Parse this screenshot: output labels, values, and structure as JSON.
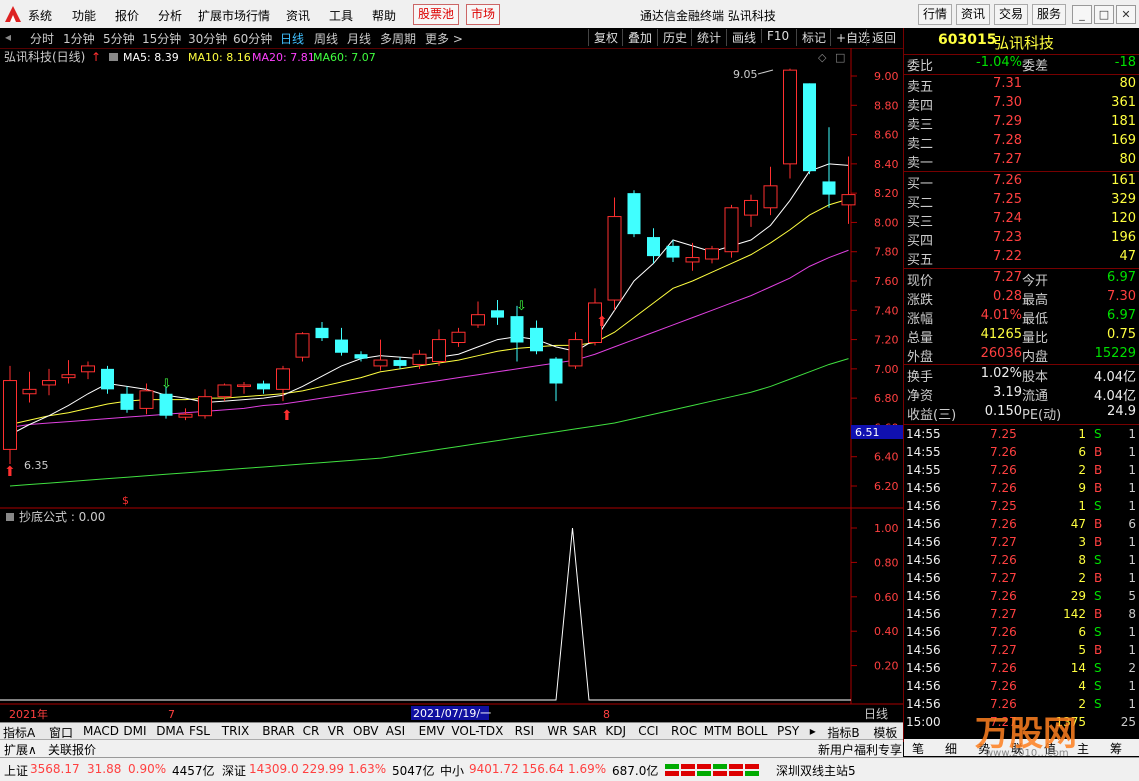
{
  "menu": [
    "系统",
    "功能",
    "报价",
    "分析",
    "扩展市场行情",
    "资讯",
    "工具",
    "帮助"
  ],
  "menu_hot": [
    "股票池",
    "市场"
  ],
  "app_title": "通达信金融终端 弘讯科技",
  "menu_right": [
    "行情",
    "资讯",
    "交易",
    "服务"
  ],
  "toolbar_left": [
    "分时",
    "1分钟",
    "5分钟",
    "15分钟",
    "30分钟",
    "60分钟",
    "日线",
    "周线",
    "月线",
    "多周期",
    "更多 >"
  ],
  "toolbar_right": [
    "复权",
    "叠加",
    "历史",
    "统计",
    "画线",
    "F10",
    "标记",
    "+自选",
    "返回"
  ],
  "chart": {
    "header_name": "弘讯科技(日线)",
    "ma5": "MA5: 8.39",
    "ma10": "MA10: 8.16",
    "ma20": "MA20: 7.81",
    "ma60": "MA60: 7.07",
    "price_labels": [
      "9.00",
      "8.80",
      "8.60",
      "8.40",
      "8.20",
      "8.00",
      "7.80",
      "7.60",
      "7.40",
      "7.20",
      "7.00",
      "6.80",
      "6.60",
      "6.40",
      "6.20"
    ],
    "current_price_tag": "6.51",
    "high_label": "9.05",
    "low_label": "6.35",
    "indicator_header": "抄底公式 : 0.00",
    "indicator_labels": [
      "1.00",
      "0.80",
      "0.60",
      "0.40",
      "0.20"
    ],
    "date_labels": [
      "2021年",
      "7",
      "8"
    ],
    "date_cursor": "2021/07/19/一",
    "period_label": "日线"
  },
  "chart_data": {
    "type": "candlestick",
    "ylim": [
      6.1,
      9.1
    ],
    "candles": [
      {
        "o": 6.45,
        "h": 7.02,
        "l": 6.35,
        "c": 6.92
      },
      {
        "o": 6.83,
        "h": 6.98,
        "l": 6.77,
        "c": 6.86
      },
      {
        "o": 6.89,
        "h": 7.0,
        "l": 6.82,
        "c": 6.92
      },
      {
        "o": 6.94,
        "h": 7.06,
        "l": 6.9,
        "c": 6.96
      },
      {
        "o": 6.98,
        "h": 7.05,
        "l": 6.93,
        "c": 7.02
      },
      {
        "o": 7.0,
        "h": 7.02,
        "l": 6.83,
        "c": 6.86
      },
      {
        "o": 6.83,
        "h": 6.88,
        "l": 6.7,
        "c": 6.72
      },
      {
        "o": 6.73,
        "h": 6.9,
        "l": 6.69,
        "c": 6.85
      },
      {
        "o": 6.83,
        "h": 6.88,
        "l": 6.66,
        "c": 6.68
      },
      {
        "o": 6.67,
        "h": 6.73,
        "l": 6.65,
        "c": 6.69
      },
      {
        "o": 6.68,
        "h": 6.86,
        "l": 6.66,
        "c": 6.81
      },
      {
        "o": 6.81,
        "h": 6.9,
        "l": 6.78,
        "c": 6.89
      },
      {
        "o": 6.88,
        "h": 6.91,
        "l": 6.83,
        "c": 6.89
      },
      {
        "o": 6.9,
        "h": 6.92,
        "l": 6.83,
        "c": 6.86
      },
      {
        "o": 6.86,
        "h": 7.02,
        "l": 6.78,
        "c": 7.0
      },
      {
        "o": 7.08,
        "h": 7.25,
        "l": 7.05,
        "c": 7.24
      },
      {
        "o": 7.28,
        "h": 7.32,
        "l": 7.19,
        "c": 7.21
      },
      {
        "o": 7.2,
        "h": 7.28,
        "l": 7.09,
        "c": 7.11
      },
      {
        "o": 7.1,
        "h": 7.12,
        "l": 7.05,
        "c": 7.07
      },
      {
        "o": 7.02,
        "h": 7.2,
        "l": 6.99,
        "c": 7.06
      },
      {
        "o": 7.06,
        "h": 7.08,
        "l": 7.0,
        "c": 7.02
      },
      {
        "o": 7.03,
        "h": 7.13,
        "l": 7.0,
        "c": 7.1
      },
      {
        "o": 7.05,
        "h": 7.27,
        "l": 7.02,
        "c": 7.2
      },
      {
        "o": 7.18,
        "h": 7.28,
        "l": 7.15,
        "c": 7.25
      },
      {
        "o": 7.3,
        "h": 7.46,
        "l": 7.28,
        "c": 7.37
      },
      {
        "o": 7.4,
        "h": 7.47,
        "l": 7.3,
        "c": 7.35
      },
      {
        "o": 7.36,
        "h": 7.43,
        "l": 7.05,
        "c": 7.18
      },
      {
        "o": 7.28,
        "h": 7.33,
        "l": 7.1,
        "c": 7.12
      },
      {
        "o": 7.07,
        "h": 7.08,
        "l": 6.78,
        "c": 6.9
      },
      {
        "o": 7.02,
        "h": 7.25,
        "l": 7.0,
        "c": 7.2
      },
      {
        "o": 7.18,
        "h": 7.55,
        "l": 7.16,
        "c": 7.45
      },
      {
        "o": 7.47,
        "h": 8.17,
        "l": 7.4,
        "c": 8.04
      },
      {
        "o": 8.2,
        "h": 8.22,
        "l": 7.9,
        "c": 7.92
      },
      {
        "o": 7.9,
        "h": 7.96,
        "l": 7.72,
        "c": 7.77
      },
      {
        "o": 7.84,
        "h": 7.88,
        "l": 7.73,
        "c": 7.76
      },
      {
        "o": 7.73,
        "h": 7.86,
        "l": 7.67,
        "c": 7.76
      },
      {
        "o": 7.75,
        "h": 7.84,
        "l": 7.72,
        "c": 7.82
      },
      {
        "o": 7.8,
        "h": 8.12,
        "l": 7.76,
        "c": 8.1
      },
      {
        "o": 8.05,
        "h": 8.19,
        "l": 7.97,
        "c": 8.15
      },
      {
        "o": 8.1,
        "h": 8.38,
        "l": 8.05,
        "c": 8.25
      },
      {
        "o": 8.4,
        "h": 9.05,
        "l": 8.3,
        "c": 9.04
      },
      {
        "o": 8.95,
        "h": 8.95,
        "l": 8.33,
        "c": 8.35
      },
      {
        "o": 8.28,
        "h": 8.65,
        "l": 8.1,
        "c": 8.19
      },
      {
        "o": 8.12,
        "h": 8.45,
        "l": 7.99,
        "c": 8.19
      }
    ],
    "ma5": [
      6.55,
      6.62,
      6.68,
      6.75,
      6.83,
      6.9,
      6.88,
      6.86,
      6.82,
      6.8,
      6.77,
      6.78,
      6.79,
      6.8,
      6.82,
      6.88,
      6.95,
      7.02,
      7.07,
      7.09,
      7.08,
      7.07,
      7.08,
      7.1,
      7.15,
      7.2,
      7.22,
      7.2,
      7.15,
      7.12,
      7.2,
      7.4,
      7.6,
      7.72,
      7.88,
      7.84,
      7.8,
      7.84,
      7.88,
      7.98,
      8.15,
      8.35,
      8.4,
      8.39
    ],
    "ma10": [
      6.62,
      6.65,
      6.68,
      6.7,
      6.73,
      6.76,
      6.78,
      6.79,
      6.79,
      6.79,
      6.8,
      6.8,
      6.81,
      6.82,
      6.83,
      6.85,
      6.88,
      6.91,
      6.94,
      6.98,
      7.0,
      7.02,
      7.04,
      7.06,
      7.09,
      7.12,
      7.14,
      7.15,
      7.16,
      7.16,
      7.18,
      7.25,
      7.35,
      7.45,
      7.55,
      7.6,
      7.66,
      7.72,
      7.78,
      7.86,
      7.95,
      8.05,
      8.12,
      8.16
    ],
    "ma20": [
      6.6,
      6.62,
      6.63,
      6.64,
      6.65,
      6.66,
      6.67,
      6.68,
      6.69,
      6.7,
      6.71,
      6.72,
      6.73,
      6.75,
      6.76,
      6.78,
      6.8,
      6.82,
      6.84,
      6.86,
      6.88,
      6.9,
      6.92,
      6.94,
      6.96,
      6.98,
      7.0,
      7.02,
      7.04,
      7.06,
      7.1,
      7.15,
      7.2,
      7.25,
      7.3,
      7.35,
      7.4,
      7.45,
      7.5,
      7.56,
      7.62,
      7.7,
      7.76,
      7.81
    ],
    "ma60": [
      6.2,
      6.21,
      6.22,
      6.23,
      6.24,
      6.25,
      6.26,
      6.27,
      6.28,
      6.29,
      6.3,
      6.31,
      6.32,
      6.33,
      6.34,
      6.35,
      6.36,
      6.37,
      6.38,
      6.39,
      6.41,
      6.43,
      6.45,
      6.47,
      6.49,
      6.51,
      6.53,
      6.55,
      6.57,
      6.59,
      6.61,
      6.63,
      6.66,
      6.69,
      6.72,
      6.75,
      6.78,
      6.81,
      6.84,
      6.88,
      6.93,
      6.98,
      7.03,
      7.07
    ],
    "signal": {
      "index": 29,
      "value": 1.0
    }
  },
  "stock": {
    "code": "603015",
    "name": "弘讯科技",
    "weibi_label": "委比",
    "weibi": "-1.04%",
    "weicha_label": "委差",
    "weicha": "-18"
  },
  "sell_orders": [
    {
      "label": "卖五",
      "price": "7.31",
      "vol": "80"
    },
    {
      "label": "卖四",
      "price": "7.30",
      "vol": "361"
    },
    {
      "label": "卖三",
      "price": "7.29",
      "vol": "181"
    },
    {
      "label": "卖二",
      "price": "7.28",
      "vol": "169"
    },
    {
      "label": "卖一",
      "price": "7.27",
      "vol": "80"
    }
  ],
  "buy_orders": [
    {
      "label": "买一",
      "price": "7.26",
      "vol": "161"
    },
    {
      "label": "买二",
      "price": "7.25",
      "vol": "329"
    },
    {
      "label": "买三",
      "price": "7.24",
      "vol": "120"
    },
    {
      "label": "买四",
      "price": "7.23",
      "vol": "196"
    },
    {
      "label": "买五",
      "price": "7.22",
      "vol": "47"
    }
  ],
  "quote": [
    {
      "l1": "现价",
      "v1": "7.27",
      "l2": "今开",
      "v2": "6.97"
    },
    {
      "l1": "涨跌",
      "v1": "0.28",
      "l2": "最高",
      "v2": "7.30"
    },
    {
      "l1": "涨幅",
      "v1": "4.01%",
      "l2": "最低",
      "v2": "6.97"
    },
    {
      "l1": "总量",
      "v1": "41265",
      "l2": "量比",
      "v2": "0.75"
    },
    {
      "l1": "外盘",
      "v1": "26036",
      "l2": "内盘",
      "v2": "15229"
    }
  ],
  "fundamentals": [
    {
      "l1": "换手",
      "v1": "1.02%",
      "l2": "股本",
      "v2": "4.04亿"
    },
    {
      "l1": "净资",
      "v1": "3.19",
      "l2": "流通",
      "v2": "4.04亿"
    },
    {
      "l1": "收益(三)",
      "v1": "0.150",
      "l2": "PE(动)",
      "v2": "24.9"
    }
  ],
  "trades": [
    {
      "t": "14:55",
      "p": "7.25",
      "v": "1",
      "s": "S",
      "n": "1"
    },
    {
      "t": "14:55",
      "p": "7.26",
      "v": "6",
      "s": "B",
      "n": "1"
    },
    {
      "t": "14:55",
      "p": "7.26",
      "v": "2",
      "s": "B",
      "n": "1"
    },
    {
      "t": "14:56",
      "p": "7.26",
      "v": "9",
      "s": "B",
      "n": "1"
    },
    {
      "t": "14:56",
      "p": "7.25",
      "v": "1",
      "s": "S",
      "n": "1"
    },
    {
      "t": "14:56",
      "p": "7.26",
      "v": "47",
      "s": "B",
      "n": "6"
    },
    {
      "t": "14:56",
      "p": "7.27",
      "v": "3",
      "s": "B",
      "n": "1"
    },
    {
      "t": "14:56",
      "p": "7.26",
      "v": "8",
      "s": "S",
      "n": "1"
    },
    {
      "t": "14:56",
      "p": "7.27",
      "v": "2",
      "s": "B",
      "n": "1"
    },
    {
      "t": "14:56",
      "p": "7.26",
      "v": "29",
      "s": "S",
      "n": "5"
    },
    {
      "t": "14:56",
      "p": "7.27",
      "v": "142",
      "s": "B",
      "n": "8"
    },
    {
      "t": "14:56",
      "p": "7.26",
      "v": "6",
      "s": "S",
      "n": "1"
    },
    {
      "t": "14:56",
      "p": "7.27",
      "v": "5",
      "s": "B",
      "n": "1"
    },
    {
      "t": "14:56",
      "p": "7.26",
      "v": "14",
      "s": "S",
      "n": "2"
    },
    {
      "t": "14:56",
      "p": "7.26",
      "v": "4",
      "s": "S",
      "n": "1"
    },
    {
      "t": "14:56",
      "p": "7.26",
      "v": "2",
      "s": "S",
      "n": "1"
    },
    {
      "t": "15:00",
      "p": "7.27",
      "v": "1375",
      "s": "",
      "n": "25"
    }
  ],
  "rp_tabs": [
    "笔",
    "细",
    "势",
    "联",
    "值",
    "主",
    "筹"
  ],
  "indicator_tabs": [
    "指标A",
    "窗口",
    "MACD",
    "DMI",
    "DMA",
    "FSL",
    "TRIX",
    "BRAR",
    "CR",
    "VR",
    "OBV",
    "ASI",
    "EMV",
    "VOL-TDX",
    "RSI",
    "WR",
    "SAR",
    "KDJ",
    "CCI",
    "ROC",
    "MTM",
    "BOLL",
    "PSY",
    "▸",
    "指标B",
    "模板",
    "+",
    "▾"
  ],
  "bottom_tabs": [
    "扩展∧",
    "关联报价"
  ],
  "promo": "新用户福利专享",
  "watermark": "万股网",
  "watermark_url": "www.2010…com",
  "status": {
    "sh_label": "上证",
    "sh": "3568.17",
    "sh_chg": "31.88",
    "sh_pct": "0.90%",
    "sh_amt": "4457亿",
    "sz_label": "深证",
    "sz": "14309.0",
    "sz_chg": "229.99",
    "sz_pct": "1.63%",
    "sz_amt": "5047亿",
    "zx_label": "中小",
    "zx": "9401.72",
    "zx_chg": "156.64",
    "zx_pct": "1.69%",
    "zx_amt": "687.0亿",
    "server": "深圳双线主站5"
  }
}
